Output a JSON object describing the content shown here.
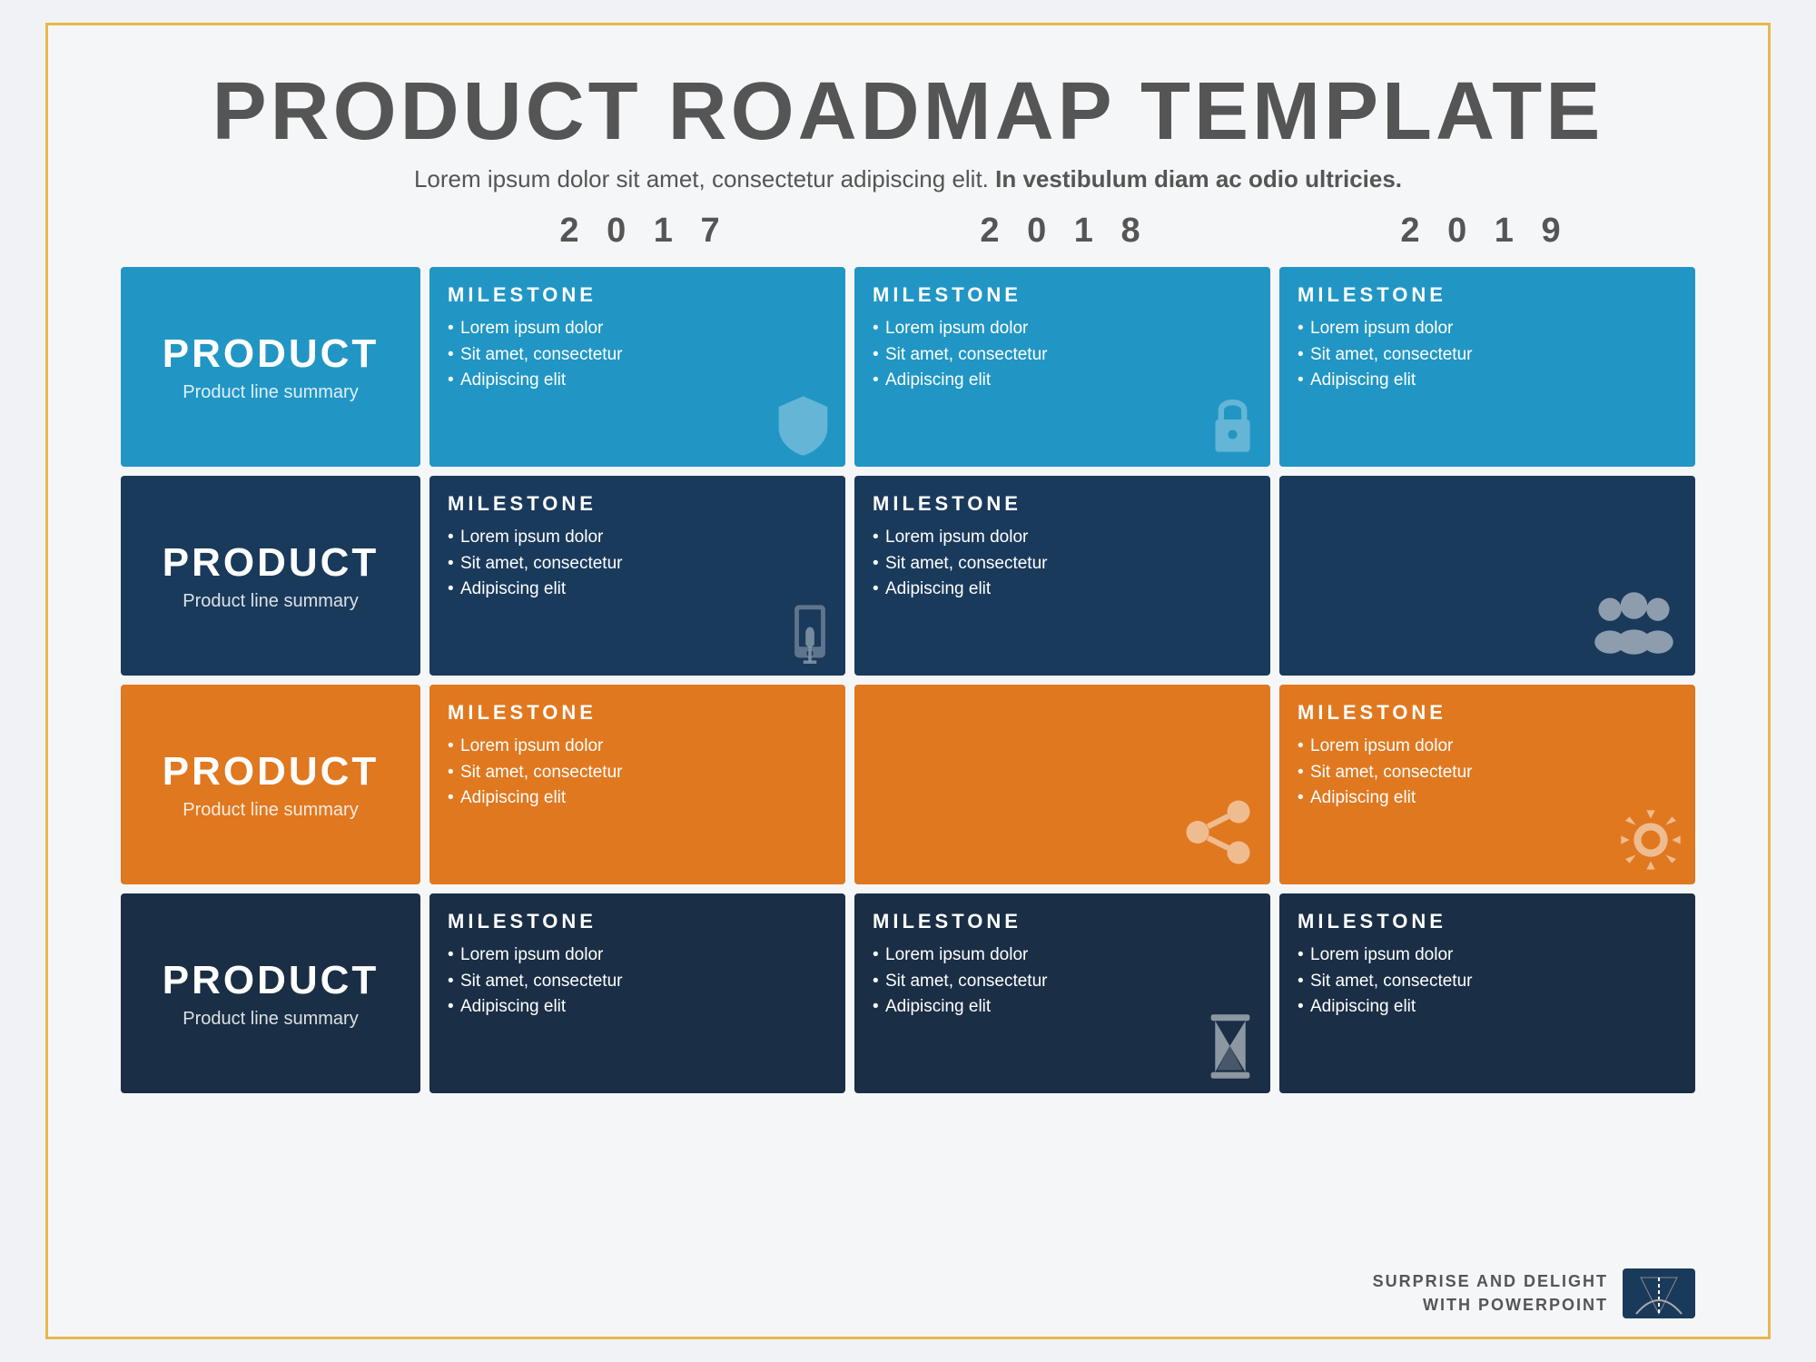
{
  "slide": {
    "title": "PRODUCT ROADMAP TEMPLATE",
    "subtitle": "Lorem ipsum dolor sit amet, consectetur adipiscing elit.",
    "subtitle_bold": "In vestibulum diam ac odio ultricies.",
    "years": [
      "2 0 1 7",
      "2 0 1 8",
      "2 0 1 9"
    ],
    "milestone_header": "MILESTONE",
    "milestone_items": [
      "Lorem ipsum dolor",
      "Sit amet, consectetur",
      "Adipiscing elit"
    ],
    "rows": [
      {
        "product_title": "PRODUCT",
        "product_summary": "Product line summary",
        "color": "blue",
        "cells": [
          {
            "color": "blue",
            "has_content": true,
            "icon": "shield"
          },
          {
            "color": "blue",
            "has_content": true,
            "icon": "lock"
          },
          {
            "color": "blue",
            "has_content": true,
            "icon": "none"
          }
        ]
      },
      {
        "product_title": "PRODUCT",
        "product_summary": "Product line summary",
        "color": "dark-blue",
        "cells": [
          {
            "color": "dark-blue",
            "has_content": true,
            "icon": "phone"
          },
          {
            "color": "dark-blue",
            "has_content": true,
            "icon": "none"
          },
          {
            "color": "dark-blue",
            "has_content": false,
            "icon": "team"
          }
        ]
      },
      {
        "product_title": "PRODUCT",
        "product_summary": "Product line summary",
        "color": "orange",
        "cells": [
          {
            "color": "orange",
            "has_content": true,
            "icon": "none"
          },
          {
            "color": "orange",
            "has_content": false,
            "icon": "share"
          },
          {
            "color": "orange",
            "has_content": true,
            "icon": "gear"
          }
        ]
      },
      {
        "product_title": "PRODUCT",
        "product_summary": "Product line summary",
        "color": "navy",
        "cells": [
          {
            "color": "navy",
            "has_content": true,
            "icon": "none"
          },
          {
            "color": "navy",
            "has_content": true,
            "icon": "hourglass"
          },
          {
            "color": "navy",
            "has_content": true,
            "icon": "none"
          }
        ]
      }
    ],
    "footer": {
      "line1": "SURPRISE AND DELIGHT",
      "line2": "WITH POWERPOINT"
    }
  }
}
